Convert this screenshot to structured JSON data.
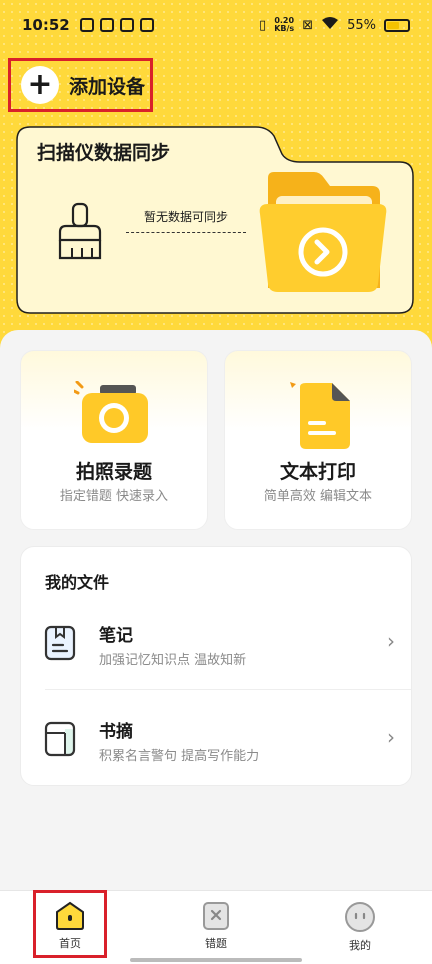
{
  "status_bar": {
    "time": "10:52",
    "net_speed_value": "0.20",
    "net_speed_unit": "KB/s",
    "battery": "55%",
    "battery_level": 0.55
  },
  "header": {
    "add_device_label": "添加设备"
  },
  "sync_card": {
    "title": "扫描仪数据同步",
    "empty_text": "暂无数据可同步"
  },
  "actions": [
    {
      "title": "拍照录题",
      "subtitle": "指定错题 快速录入"
    },
    {
      "title": "文本打印",
      "subtitle": "简单高效 编辑文本"
    }
  ],
  "files": {
    "title": "我的文件",
    "items": [
      {
        "name": "笔记",
        "subtitle": "加强记忆知识点 温故知新"
      },
      {
        "name": "书摘",
        "subtitle": "积累名言警句 提高写作能力"
      }
    ]
  },
  "nav": {
    "items": [
      {
        "label": "首页"
      },
      {
        "label": "错题"
      },
      {
        "label": "我的"
      }
    ]
  },
  "colors": {
    "accent": "#ffd93b",
    "highlight_border": "#d9202a"
  }
}
